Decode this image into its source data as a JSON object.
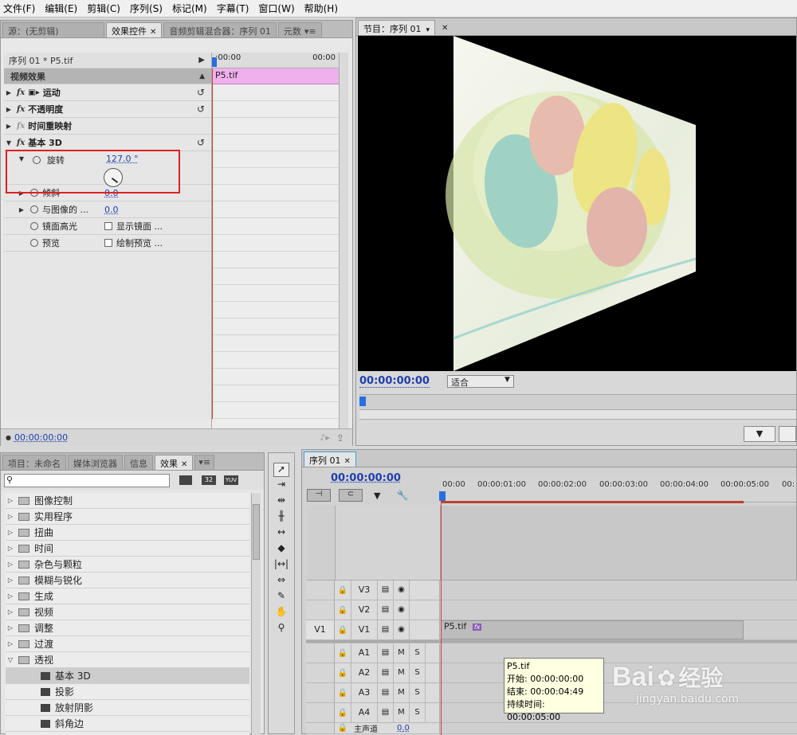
{
  "menu": [
    "文件(F)",
    "编辑(E)",
    "剪辑(C)",
    "序列(S)",
    "标记(M)",
    "字幕(T)",
    "窗口(W)",
    "帮助(H)"
  ],
  "source_panel": {
    "tabs": [
      "源：(无剪辑)",
      "效果控件",
      "音频剪辑混合器：序列 01",
      "元数"
    ],
    "clip_path": "序列 01 * P5.tif",
    "ruler_start": ":00:00",
    "ruler_end": "00:00",
    "section_title": "视频效果",
    "effects": [
      {
        "label": "运动",
        "fx": "fx"
      },
      {
        "label": "不透明度",
        "fx": "fx"
      },
      {
        "label": "时间重映射",
        "fx": "fx"
      },
      {
        "label": "基本 3D",
        "fx": "fx"
      }
    ],
    "params": {
      "rotate_label": "旋转",
      "rotate_value": "127.0 °",
      "tilt_label": "倾斜",
      "tilt_value": "0.0",
      "distance_label": "与图像的 ...",
      "distance_value": "0.0",
      "specular_label": "镜面高光",
      "specular_check": "显示镜面 ...",
      "preview_label": "预览",
      "preview_check": "绘制预览 ..."
    },
    "clip_name": "P5.tif",
    "timecode": "00:00:00:00"
  },
  "program_panel": {
    "tab": "节目：序列 01",
    "timecode": "00:00:00:00",
    "fit_label": "适合"
  },
  "project_panel": {
    "tabs": [
      "项目：未命名",
      "媒体浏览器",
      "信息",
      "效果"
    ],
    "search_placeholder": "",
    "icon_badges": [
      "32",
      "YUV"
    ],
    "folders": [
      "图像控制",
      "实用程序",
      "扭曲",
      "时间",
      "杂色与颗粒",
      "模糊与锐化",
      "生成",
      "视频",
      "调整",
      "过渡",
      "透视"
    ],
    "perspective_items": [
      "基本 3D",
      "投影",
      "放射阴影",
      "斜角边"
    ]
  },
  "timeline": {
    "tab": "序列 01",
    "timecode": "00:00:00:00",
    "ruler": [
      "00:00",
      "00:00:01:00",
      "00:00:02:00",
      "00:00:03:00",
      "00:00:04:00",
      "00:00:05:00",
      "00:"
    ],
    "video_tracks": [
      "V3",
      "V2",
      "V1"
    ],
    "source_patch": "V1",
    "audio_tracks": [
      "A1",
      "A2",
      "A3",
      "A4"
    ],
    "master_label": "主声道",
    "master_value": "0.0",
    "clip_label": "P5.tif",
    "clip_fx": "fx",
    "mute": "M",
    "solo": "S"
  },
  "tooltip": {
    "title": "P5.tif",
    "start": "开始: 00:00:00:00",
    "end": "结束: 00:00:04:49",
    "duration": "持续时间: 00:00:05:00"
  },
  "watermark": {
    "brand": "Bai",
    "brand2": "经验",
    "url": "jingyan.baidu.com"
  },
  "colors": {
    "accent_blue": "#1f3fb0",
    "clip_pink": "#f0b0ee",
    "playhead": "#d04030",
    "highlight_red": "#e02020"
  }
}
